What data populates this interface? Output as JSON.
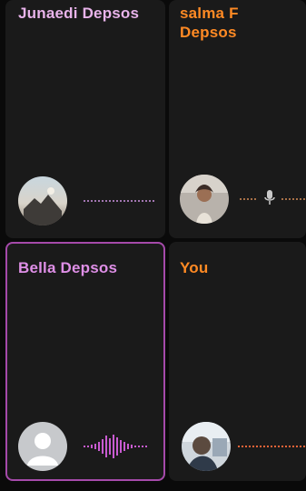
{
  "participants": [
    {
      "name": "Junaedi Depsos",
      "name_color": "#e8b3ea",
      "wave_color": "#b07fc2",
      "speaking": false,
      "active": false,
      "muted": false,
      "avatar": "photo-landscape"
    },
    {
      "name": "salma F Depsos",
      "name_color": "#ff8a24",
      "wave_color": "#b77a4c",
      "speaking": false,
      "active": false,
      "muted": true,
      "avatar": "photo-person"
    },
    {
      "name": "Bella Depsos",
      "name_color": "#df8fe7",
      "wave_color": "#c85bd0",
      "speaking": true,
      "active": true,
      "muted": false,
      "avatar": "default-user"
    },
    {
      "name": "You",
      "name_color": "#ff8a24",
      "wave_color": "#ff6b3a",
      "speaking": false,
      "active": false,
      "muted": false,
      "avatar": "photo-self"
    }
  ]
}
